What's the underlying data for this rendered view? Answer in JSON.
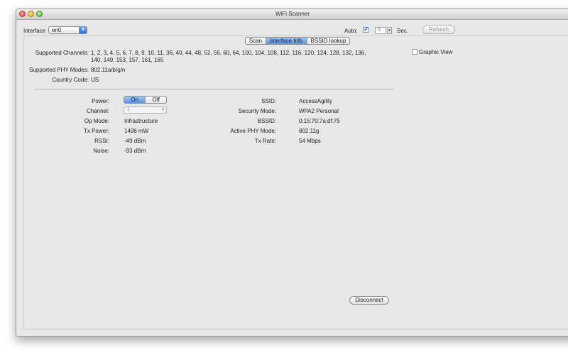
{
  "window": {
    "title": "WiFi Scanner"
  },
  "toolbar": {
    "interface_label": "Interface",
    "interface_value": "en0",
    "auto_label": "Auto:",
    "auto_checked": true,
    "interval_value": "5",
    "sec_label": "Sec.",
    "refresh_label": "Refresh"
  },
  "tabs": [
    {
      "label": "Scan",
      "selected": false
    },
    {
      "label": "Interface Info",
      "selected": true
    },
    {
      "label": "BSSID lookup",
      "selected": false
    }
  ],
  "info": {
    "channels_label": "Supported Channels:",
    "channels_line1": "1, 2, 3, 4, 5, 6, 7, 8, 9, 10, 11, 36, 40, 44, 48, 52, 56, 60, 64, 100, 104, 108, 112, 116, 120, 124, 128, 132, 136,",
    "channels_line2": "140, 149, 153, 157, 161, 165",
    "phy_modes_label": "Supported PHY Modes:",
    "phy_modes_value": "802.11a/b/g/n",
    "country_label": "Country Code:",
    "country_value": "US",
    "graphic_view_label": "Graphic View"
  },
  "details": {
    "power_label": "Power:",
    "power_on": "On",
    "power_off": "Off",
    "channel_label": "Channel:",
    "channel_value": "1",
    "op_mode_label": "Op Mode:",
    "op_mode_value": "Infrastructure",
    "tx_power_label": "Tx Power:",
    "tx_power_value": "1496 mW",
    "rssi_label": "RSSI:",
    "rssi_value": "-49 dBm",
    "noise_label": "Noise:",
    "noise_value": "-93 dBm",
    "ssid_label": "SSID:",
    "ssid_value": "AccessAgility",
    "security_label": "Security Mode:",
    "security_value": "WPA2 Personal",
    "bssid_label": "BSSID:",
    "bssid_value": "0:15:70:7a:df:75",
    "active_phy_label": "Active PHY Mode:",
    "active_phy_value": "802.11g",
    "tx_rate_label": "Tx Rate:",
    "tx_rate_value": "54 Mbps"
  },
  "disconnect_label": "Disconnect",
  "colors": {
    "accent": "#5b96e4",
    "window_bg": "#e8e8e8"
  }
}
